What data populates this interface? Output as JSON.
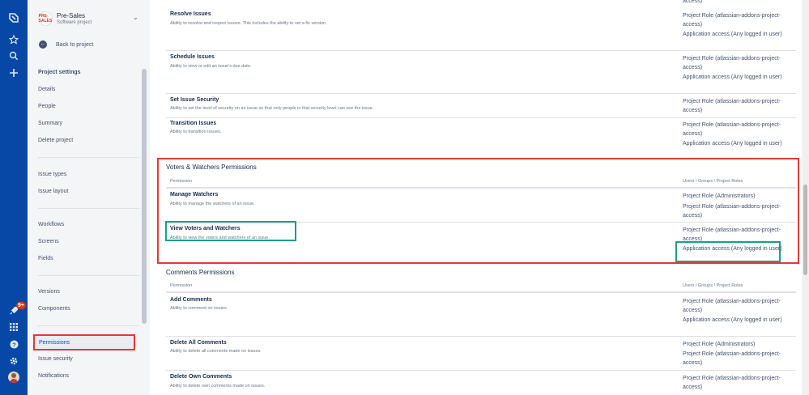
{
  "project": {
    "name": "Pre-Sales",
    "type": "Software project",
    "logo_text": "PRE-SALES"
  },
  "nav": {
    "back_label": "Back to project",
    "notification_count": "9+"
  },
  "sidebar": {
    "heading": "Project settings",
    "items": [
      {
        "label": "Details"
      },
      {
        "label": "People"
      },
      {
        "label": "Summary"
      },
      {
        "label": "Delete project"
      },
      {
        "label": "Issue types"
      },
      {
        "label": "Issue layout"
      },
      {
        "label": "Workflows"
      },
      {
        "label": "Screens"
      },
      {
        "label": "Fields"
      },
      {
        "label": "Versions"
      },
      {
        "label": "Components"
      },
      {
        "label": "Permissions",
        "active": true
      },
      {
        "label": "Issue security"
      },
      {
        "label": "Notifications"
      }
    ]
  },
  "grants": {
    "role_addons": "Project Role (atlassian-addons-project-access)",
    "app_access": "Application access (Any logged in user)",
    "role_admins": "Project Role (Administrators)",
    "truncated_user": "user)"
  },
  "sections": [
    {
      "title": "",
      "permissions": [
        {
          "name": "Resolve Issues",
          "desc": "Ability to resolve and reopen issues. This includes the ability to set a fix version."
        },
        {
          "name": "Schedule Issues",
          "desc": "Ability to view or edit an issue's due date."
        },
        {
          "name": "Set Issue Security",
          "desc": "Ability to set the level of security on an issue so that only people in that security level can see the issue."
        },
        {
          "name": "Transition Issues",
          "desc": "Ability to transition issues."
        }
      ]
    },
    {
      "title": "Voters & Watchers Permissions",
      "col_permission": "Permission",
      "col_users": "Users / Groups / Project Roles",
      "permissions": [
        {
          "name": "Manage Watchers",
          "desc": "Ability to manage the watchers of an issue."
        },
        {
          "name": "View Voters and Watchers",
          "desc": "Ability to view the voters and watchers of an issue."
        }
      ]
    },
    {
      "title": "Comments Permissions",
      "col_permission": "Permission",
      "col_users": "Users / Groups / Project Roles",
      "permissions": [
        {
          "name": "Add Comments",
          "desc": "Ability to comment on issues."
        },
        {
          "name": "Delete All Comments",
          "desc": "Ability to delete all comments made on issues."
        },
        {
          "name": "Delete Own Comments",
          "desc": "Ability to delete own comments made on issues."
        }
      ]
    }
  ],
  "colors": {
    "global_nav": "#0747a6",
    "sidebar_bg": "#f4f5f7",
    "highlight_red": "#e53935",
    "highlight_green": "#1a9e86"
  }
}
